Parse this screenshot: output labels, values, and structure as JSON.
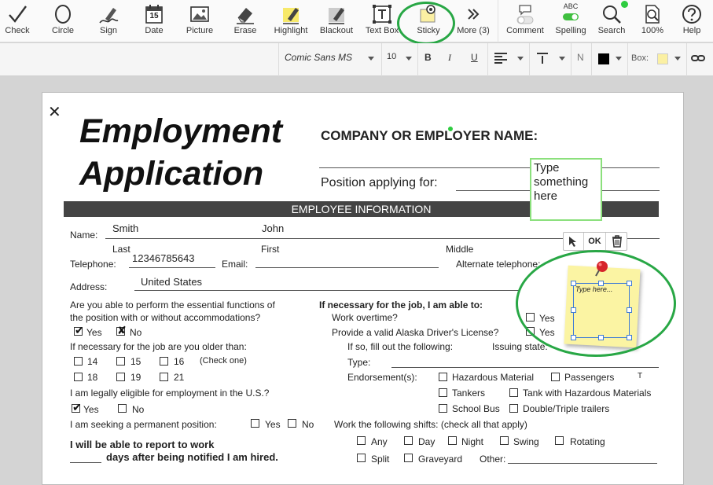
{
  "toolbar": {
    "check": "Check",
    "circle": "Circle",
    "sign": "Sign",
    "date": "Date",
    "date_day": "15",
    "picture": "Picture",
    "erase": "Erase",
    "highlight": "Highlight",
    "blackout": "Blackout",
    "textbox": "Text Box",
    "sticky": "Sticky",
    "more": "More (3)",
    "comment": "Comment",
    "spelling_caption": "ABC",
    "spelling": "Spelling",
    "search": "Search",
    "zoom": "100%",
    "help": "Help"
  },
  "format": {
    "font": "Comic Sans MS",
    "size": "10",
    "bold": "B",
    "italic": "I",
    "underline": "U",
    "n_label": "N",
    "box_label": "Box:",
    "text_color": "#000000",
    "box_color": "#fbf0a3"
  },
  "doc": {
    "title_line1": "Employment",
    "title_line2": "Application",
    "company_label": "COMPANY OR EMPLOYER NAME:",
    "position_label": "Position applying for:",
    "section_bar": "EMPLOYEE INFORMATION",
    "name_label": "Name:",
    "last_name_value": "Smith",
    "first_name_value": "John",
    "last_caption": "Last",
    "first_caption": "First",
    "middle_caption": "Middle",
    "telephone_label": "Telephone:",
    "telephone_value": "12346785643",
    "email_label": "Email:",
    "alt_phone_label": "Alternate telephone:",
    "address_label": "Address:",
    "address_value": "United States",
    "q_functions_1": "Are you able to perform the essential functions of",
    "q_functions_2": "the position with or without accommodations?",
    "yes": "Yes",
    "no": "No",
    "q_age": "If necessary for the job are you older than:",
    "age_14": "14",
    "age_15": "15",
    "age_16": "16",
    "check_one": "(Check one)",
    "age_18": "18",
    "age_19": "19",
    "age_21": "21",
    "q_eligible": "I am legally eligible for employment in the U.S.?",
    "q_permanent": "I am seeking a permanent position:",
    "report_1": "I will be able to report to work",
    "report_2": "days after being notified I am hired.",
    "if_necessary": "If necessary for the job, I am able to:",
    "overtime": "Work overtime?",
    "license": "Provide a valid Alaska Driver's License?",
    "fill_following": "If so, fill out the following:",
    "issuing_state": "Issuing state:",
    "type_label": "Type:",
    "endorsements": "Endorsement(s):",
    "hazmat": "Hazardous Material",
    "passengers": "Passengers",
    "tankers": "Tankers",
    "tank_hazmat": "Tank with Hazardous Materials",
    "school_bus": "School Bus",
    "double_triple": "Double/Triple trailers",
    "shifts_label": "Work the following shifts: (check all that apply)",
    "any": "Any",
    "day": "Day",
    "night": "Night",
    "swing": "Swing",
    "rotating": "Rotating",
    "split": "Split",
    "graveyard": "Graveyard",
    "other": "Other:",
    "t_mark": "T",
    "checked_mark": "✔",
    "x_mark": "✘",
    "close_mark": "✕"
  },
  "textbox": {
    "text": "Type something here"
  },
  "sticky": {
    "ok_label": "OK",
    "text": "Type here..."
  }
}
